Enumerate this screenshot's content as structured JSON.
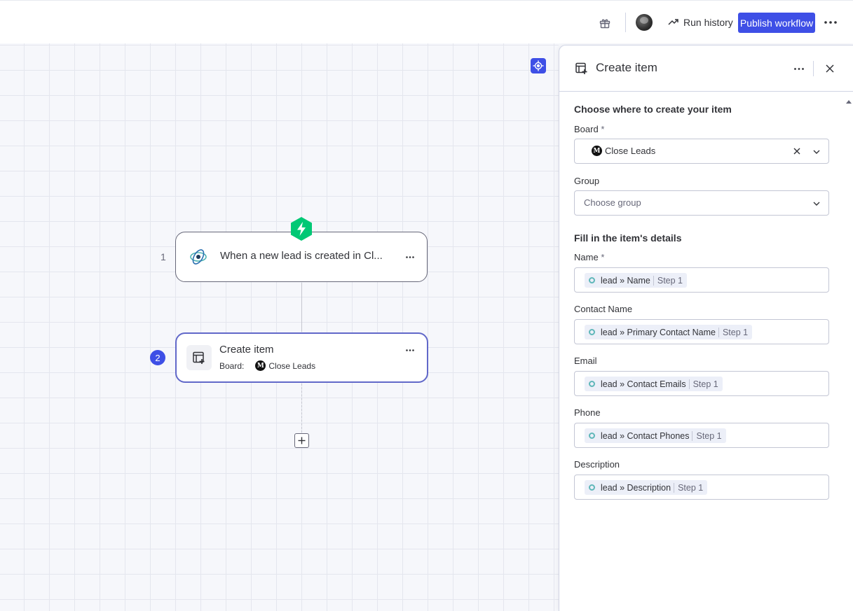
{
  "topbar": {
    "run_history": "Run history",
    "publish": "Publish workflow"
  },
  "canvas": {
    "node1": {
      "step": "1",
      "title": "When a new lead is created in Cl..."
    },
    "node2": {
      "step": "2",
      "title": "Create item",
      "board_label": "Board:",
      "board_icon": "M",
      "board_value": "Close Leads"
    }
  },
  "panel": {
    "title": "Create item",
    "section1": "Choose where to create your item",
    "board": {
      "label": "Board",
      "required": "*",
      "icon": "M",
      "value": "Close Leads"
    },
    "group": {
      "label": "Group",
      "placeholder": "Choose group"
    },
    "section2": "Fill in the item's details",
    "fields": [
      {
        "label": "Name",
        "required": "*",
        "token": "lead » Name",
        "step": "Step 1"
      },
      {
        "label": "Contact Name",
        "required": "",
        "token": "lead » Primary Contact Name",
        "step": "Step 1"
      },
      {
        "label": "Email",
        "required": "",
        "token": "lead » Contact Emails",
        "step": "Step 1"
      },
      {
        "label": "Phone",
        "required": "",
        "token": "lead » Contact Phones",
        "step": "Step 1"
      },
      {
        "label": "Description",
        "required": "",
        "token": "lead » Description",
        "step": "Step 1"
      }
    ]
  },
  "colors": {
    "accent": "#3e4fe6",
    "trigger": "#00c875",
    "node_selected_border": "#6168c9"
  }
}
